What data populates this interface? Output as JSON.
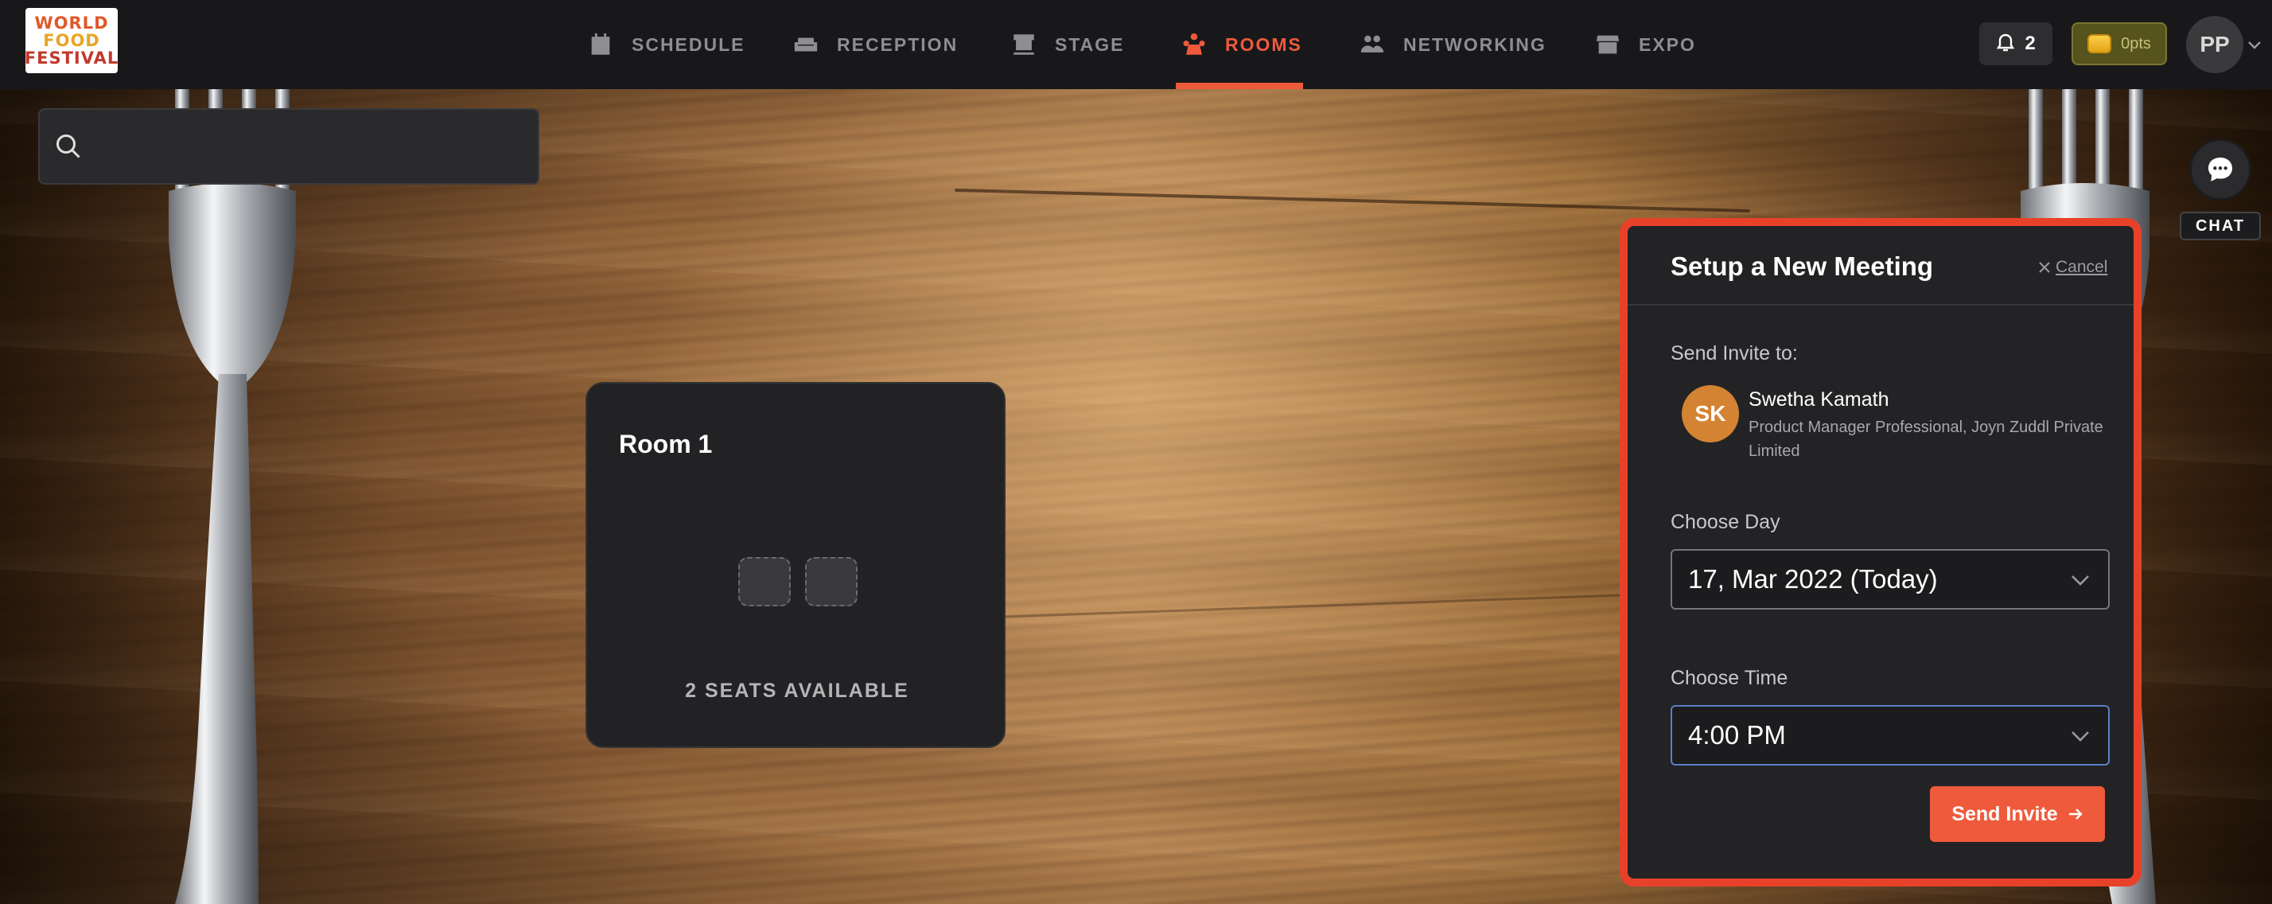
{
  "logo": {
    "line1": "WORLD",
    "line2": "FOOD",
    "line3": "FESTIVAL"
  },
  "nav": {
    "items": [
      {
        "label": "SCHEDULE",
        "icon": "calendar-icon"
      },
      {
        "label": "RECEPTION",
        "icon": "sofa-icon"
      },
      {
        "label": "STAGE",
        "icon": "stage-icon"
      },
      {
        "label": "ROOMS",
        "icon": "people-table-icon",
        "active": true
      },
      {
        "label": "NETWORKING",
        "icon": "networking-icon"
      },
      {
        "label": "EXPO",
        "icon": "store-icon"
      }
    ],
    "active_color": "#ef5a3c"
  },
  "header": {
    "notifications_count": "2",
    "points": "0pts",
    "user_initials": "PP"
  },
  "search": {
    "placeholder": "",
    "value": ""
  },
  "chat": {
    "label": "CHAT"
  },
  "room": {
    "title": "Room 1",
    "seats_text": "2 SEATS AVAILABLE",
    "seats": 2
  },
  "meeting": {
    "title": "Setup a New Meeting",
    "cancel_label": "Cancel",
    "invite_label": "Send Invite to:",
    "invitee": {
      "initials": "SK",
      "name": "Swetha Kamath",
      "role": "Product Manager Professional, Joyn Zuddl Private Limited"
    },
    "day_label": "Choose Day",
    "day_value": "17, Mar 2022 (Today)",
    "time_label": "Choose Time",
    "time_value": "4:00 PM",
    "send_label": "Send Invite",
    "border_color": "#e8412a"
  }
}
